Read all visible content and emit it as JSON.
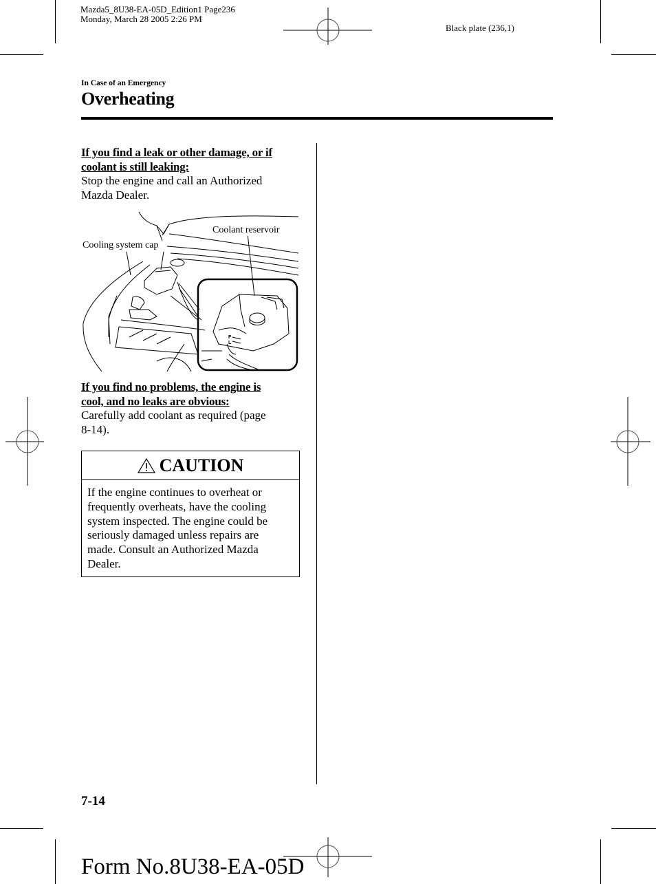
{
  "slug": {
    "line1": "Mazda5_8U38-EA-05D_Edition1 Page236",
    "line2": "Monday, March 28 2005 2:26 PM"
  },
  "plate": "Black plate (236,1)",
  "header": {
    "section": "In Case of an Emergency",
    "title": "Overheating"
  },
  "content": {
    "block1": {
      "subhead": "If you find a leak or other damage, or if coolant is still leaking:",
      "subhead_l1": "If you find a leak or other damage, or if",
      "subhead_l2": "coolant is still leaking:",
      "body_l1": "Stop the engine and call an Authorized",
      "body_l2": "Mazda Dealer."
    },
    "figure": {
      "label_cap": "Cooling system cap",
      "label_reservoir": "Coolant reservoir",
      "gauge_f": "F",
      "gauge_l": "L"
    },
    "block2": {
      "subhead_l1": "If you find no problems, the engine is",
      "subhead_l2": "cool, and no leaks are obvious:",
      "body_l1": "Carefully add coolant as required (page",
      "body_l2": "8-14)."
    },
    "caution": {
      "title": "CAUTION",
      "icon": "warning-triangle-icon",
      "lines": [
        "If the engine continues to overheat or",
        "frequently overheats, have the cooling",
        "system inspected. The engine could be",
        "seriously damaged unless repairs are",
        "made. Consult an Authorized Mazda",
        "Dealer."
      ]
    }
  },
  "footer": {
    "page_number": "7-14",
    "form_number": "Form No.8U38-EA-05D"
  }
}
